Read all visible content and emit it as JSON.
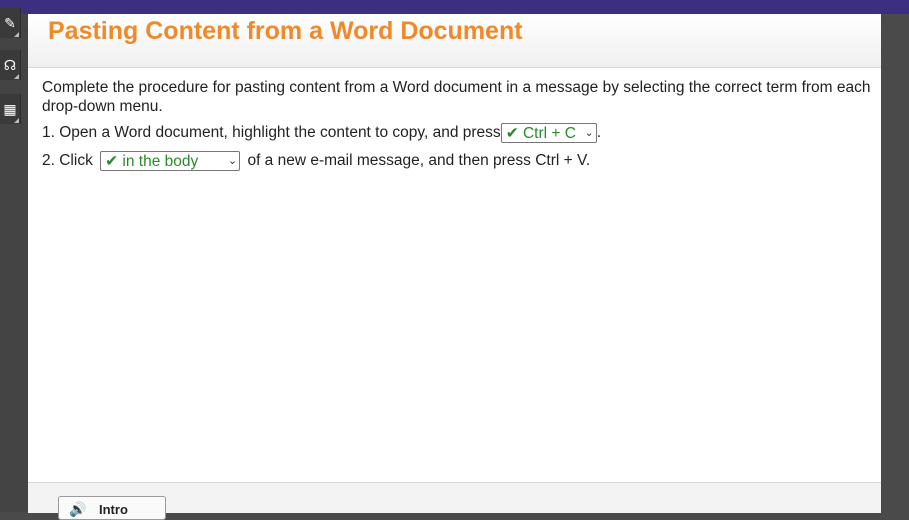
{
  "title": "Pasting Content from a Word Document",
  "instructions": "Complete the procedure for pasting content from a Word document in a message by selecting the correct term from each drop-down menu.",
  "steps": [
    {
      "before": "1. Open a Word document, highlight the content to copy, and press",
      "selected": "✔ Ctrl + C",
      "after": "."
    },
    {
      "before": "2. Click",
      "selected": "✔ in the body",
      "after": "of a new e-mail message, and then press Ctrl + V."
    }
  ],
  "footer": {
    "intro_label": "Intro"
  },
  "colors": {
    "title": "#f0892a",
    "topbar": "#3d2f7f",
    "correct": "#2a8a2a"
  }
}
